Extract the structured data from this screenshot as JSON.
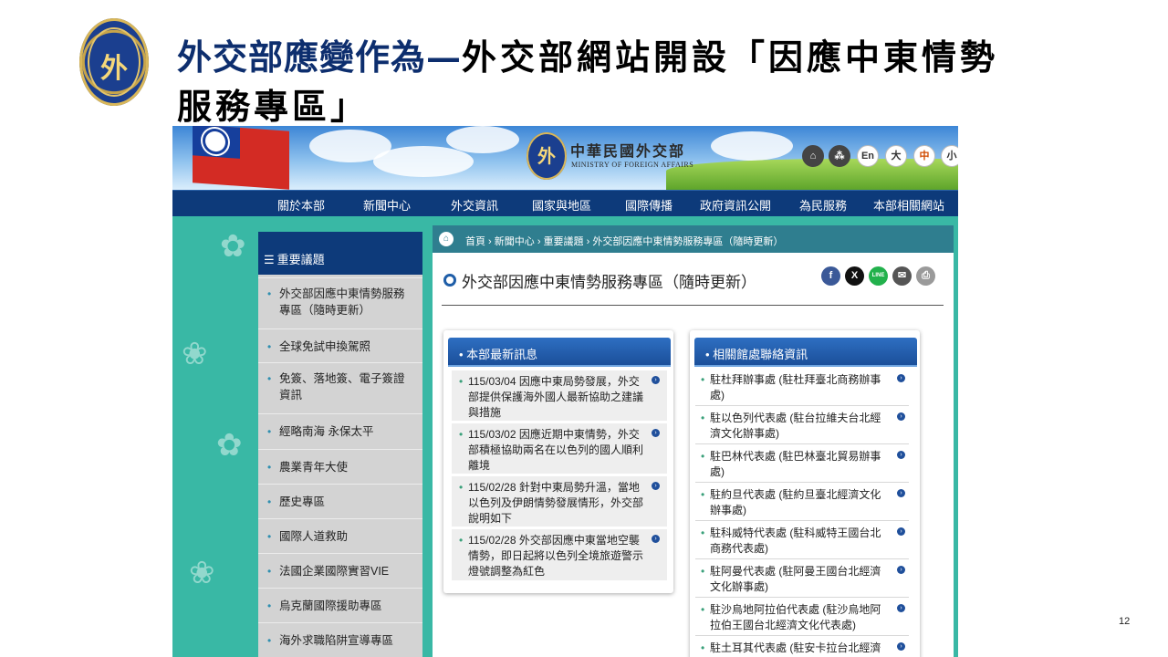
{
  "slide": {
    "title_blue": "外交部應變作為—",
    "title_black": "外交部網站開設「因應中東情勢服務專區」",
    "page_number": "12",
    "logo_glyph": "外"
  },
  "site": {
    "name": "中華民國外交部",
    "name_en": "MINISTRY OF FOREIGN AFFAIRS",
    "logo_glyph": "外",
    "utility_buttons": [
      {
        "label": "⌂",
        "icon": "home-icon"
      },
      {
        "label": "⁂",
        "icon": "sitemap-icon"
      },
      {
        "label": "En",
        "icon": "english-icon"
      },
      {
        "label": "大",
        "icon": "font-large-icon"
      },
      {
        "label": "中",
        "icon": "font-medium-icon"
      },
      {
        "label": "小",
        "icon": "font-small-icon"
      }
    ],
    "nav": [
      "關於本部",
      "新聞中心",
      "外交資訊",
      "國家與地區",
      "國際傳播",
      "政府資訊公開",
      "為民服務",
      "本部相關網站"
    ]
  },
  "sidebar": {
    "title": "重要議題",
    "title_icon": "☰",
    "items": [
      "外交部因應中東情勢服務專區（隨時更新）",
      "全球免試申換駕照",
      "免簽、落地簽、電子簽證資訊",
      "經略南海 永保太平",
      "農業青年大使",
      "歷史專區",
      "國際人道救助",
      "法國企業國際實習VIE",
      "烏克蘭國際援助專區",
      "海外求職陷阱宣導專區"
    ]
  },
  "breadcrumb": {
    "home_icon": "⌂",
    "trail": "首頁  ›  新聞中心  ›  重要議題  ›  外交部因應中東情勢服務專區（隨時更新）"
  },
  "page_heading": "外交部因應中東情勢服務專區（隨時更新）",
  "share_buttons": [
    {
      "label": "f",
      "icon": "facebook-icon",
      "color": "#3b5998"
    },
    {
      "label": "X",
      "icon": "x-icon",
      "color": "#111111"
    },
    {
      "label": "LINE",
      "icon": "line-icon",
      "color": "#22b14c"
    },
    {
      "label": "✉",
      "icon": "email-icon",
      "color": "#555555"
    },
    {
      "label": "⎙",
      "icon": "print-icon",
      "color": "#9a9a9a"
    }
  ],
  "news_panel": {
    "title": "• 本部最新訊息",
    "items": [
      "115/03/04 因應中東局勢發展，外交部提供保護海外國人最新協助之建議與措施",
      "115/03/02 因應近期中東情勢，外交部積極協助兩名在以色列的國人順利離境",
      "115/02/28 針對中東局勢升溫，當地以色列及伊朗情勢發展情形，外交部說明如下",
      "115/02/28 外交部因應中東當地空襲情勢，即日起將以色列全境旅遊警示燈號調整為紅色"
    ]
  },
  "contact_panel": {
    "title": "• 相關館處聯絡資訊",
    "items": [
      "駐杜拜辦事處 (駐杜拜臺北商務辦事處)",
      "駐以色列代表處 (駐台拉維夫台北經濟文化辦事處)",
      "駐巴林代表處 (駐巴林臺北貿易辦事處)",
      "駐約旦代表處 (駐約旦臺北經濟文化辦事處)",
      "駐科威特代表處 (駐科威特王國台北商務代表處)",
      "駐阿曼代表處 (駐阿曼王國台北經濟文化辦事處)",
      "駐沙烏地阿拉伯代表處 (駐沙烏地阿拉伯王國台北經濟文化代表處)",
      "駐土耳其代表處 (駐安卡拉台北經濟文化代表團)"
    ]
  }
}
